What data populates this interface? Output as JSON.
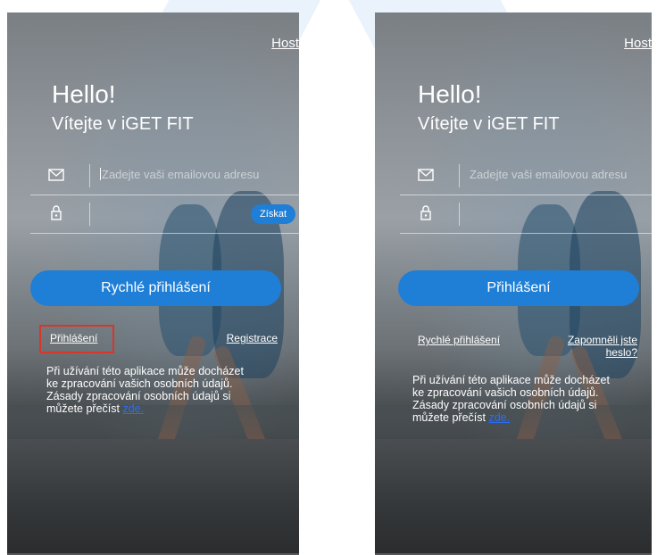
{
  "colors": {
    "accent": "#1f7fd6",
    "highlight_box": "#d9362b",
    "policy_link": "#2d6df0"
  },
  "left_screen": {
    "host_label": "Host",
    "hello": "Hello!",
    "welcome": "Vítejte v iGET FIT",
    "email_icon": "envelope-icon",
    "email_placeholder": "Zadejte vaši emailovou adresu",
    "lock_icon": "lock-icon",
    "get_code_label": "Získat",
    "primary_button_label": "Rychlé přihlášení",
    "alt_login_link": "Přihlášení",
    "register_link": "Registrace",
    "policy_text": "Při užívání této aplikace může docházet ke zpracování vašich osobních údajů. Zásady zpracování osobních údajů si můžete přečíst",
    "policy_link": "zde."
  },
  "right_screen": {
    "host_label": "Host",
    "hello": "Hello!",
    "welcome": "Vítejte v iGET FIT",
    "email_icon": "envelope-icon",
    "email_placeholder": "Zadejte vaši emailovou adresu",
    "lock_icon": "lock-icon",
    "primary_button_label": "Přihlášení",
    "quick_login_link": "Rychlé přihlášení",
    "forgot_password_link": "Zapomněli jste heslo?",
    "policy_text": "Při užívání této aplikace může docházet ke zpracování vašich osobních údajů. Zásady zpracování osobních údajů si můžete přečíst",
    "policy_link": "zde."
  }
}
